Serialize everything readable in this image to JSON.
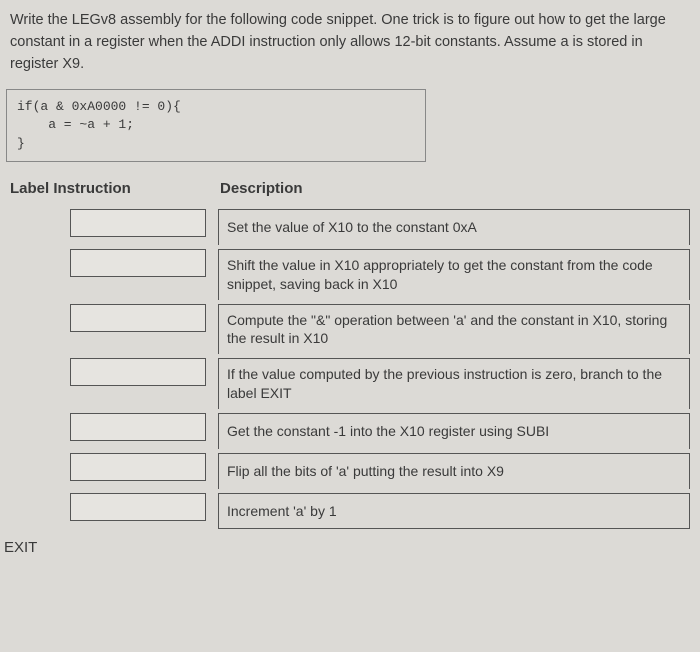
{
  "question": "Write the LEGv8 assembly for the following code snippet. One trick is to figure out how to get the large constant in a register when the ADDI instruction only allows 12-bit constants. Assume a is stored in register X9.",
  "code": {
    "line1": "if(a & 0xA0000 != 0){",
    "line2": "    a = ~a + 1;",
    "line3": "}"
  },
  "headers": {
    "label": "Label Instruction",
    "description": "Description"
  },
  "rows": [
    {
      "description": "Set the value of X10 to the constant 0xA"
    },
    {
      "description": "Shift the value in X10 appropriately to get the constant from the code snippet, saving back in X10"
    },
    {
      "description": "Compute the \"&\" operation between 'a' and the constant in X10, storing the result in X10"
    },
    {
      "description": "If the value computed by the previous instruction is zero, branch to the label EXIT"
    },
    {
      "description": "Get the constant -1 into the X10 register using SUBI"
    },
    {
      "description": "Flip all the bits of 'a' putting the result into X9"
    },
    {
      "description": "Increment 'a' by 1"
    }
  ],
  "exit_label": "EXIT"
}
